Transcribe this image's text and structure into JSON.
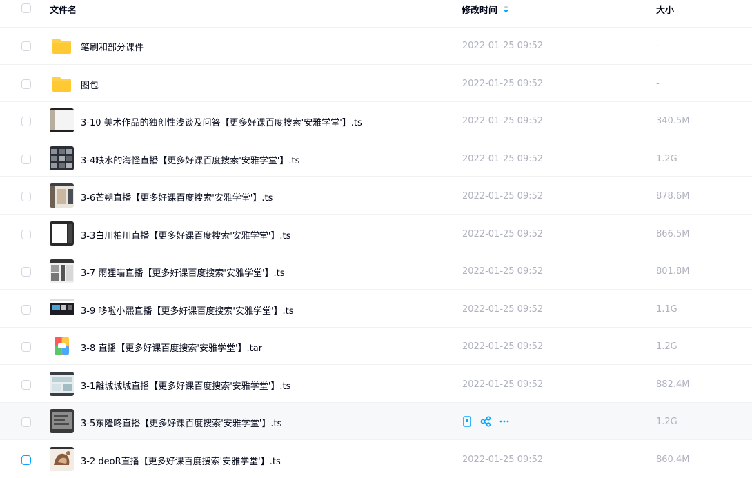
{
  "header": {
    "name_label": "文件名",
    "time_label": "修改时间",
    "size_label": "大小"
  },
  "rows": [
    {
      "name": "笔刷和部分课件",
      "time": "2022-01-25 09:52",
      "size": "-",
      "icon": "folder-icon"
    },
    {
      "name": "图包",
      "time": "2022-01-25 09:52",
      "size": "-",
      "icon": "folder-icon"
    },
    {
      "name": "3-10 美术作品的独创性浅谈及问答【更多好课百度搜索'安雅学堂'】.ts",
      "time": "2022-01-25 09:52",
      "size": "340.5M",
      "icon": "video-thumbnail"
    },
    {
      "name": "3-4缺水的海怪直播【更多好课百度搜索'安雅学堂'】.ts",
      "time": "2022-01-25 09:52",
      "size": "1.2G",
      "icon": "video-thumbnail"
    },
    {
      "name": "3-6芒朔直播【更多好课百度搜索'安雅学堂'】.ts",
      "time": "2022-01-25 09:52",
      "size": "878.6M",
      "icon": "video-thumbnail"
    },
    {
      "name": "3-3白川柏川直播【更多好课百度搜索'安雅学堂'】.ts",
      "time": "2022-01-25 09:52",
      "size": "866.5M",
      "icon": "video-thumbnail"
    },
    {
      "name": "3-7 雨狸喵直播【更多好课百度搜索'安雅学堂'】.ts",
      "time": "2022-01-25 09:52",
      "size": "801.8M",
      "icon": "video-thumbnail"
    },
    {
      "name": "3-9 哆啦小熙直播【更多好课百度搜索'安雅学堂'】.ts",
      "time": "2022-01-25 09:52",
      "size": "1.1G",
      "icon": "video-thumbnail"
    },
    {
      "name": "3-8 直播【更多好课百度搜索'安雅学堂'】.tar",
      "time": "2022-01-25 09:52",
      "size": "1.2G",
      "icon": "archive-icon"
    },
    {
      "name": "3-1離城城城直播【更多好课百度搜索'安雅学堂'】.ts",
      "time": "2022-01-25 09:52",
      "size": "882.4M",
      "icon": "video-thumbnail"
    },
    {
      "name": "3-5东隆咚直播【更多好课百度搜索'安雅学堂'】.ts",
      "time": "",
      "size": "1.2G",
      "icon": "video-thumbnail",
      "hovered": true
    },
    {
      "name": "3-2 deoR直播【更多好课百度搜索'安雅学堂'】.ts",
      "time": "2022-01-25 09:52",
      "size": "860.4M",
      "icon": "video-thumbnail"
    }
  ],
  "colors": {
    "accent": "#06a7ff",
    "folder": "#ffd04a",
    "muted_text": "#afb3bf",
    "hover_bg": "#f7f8fa"
  }
}
